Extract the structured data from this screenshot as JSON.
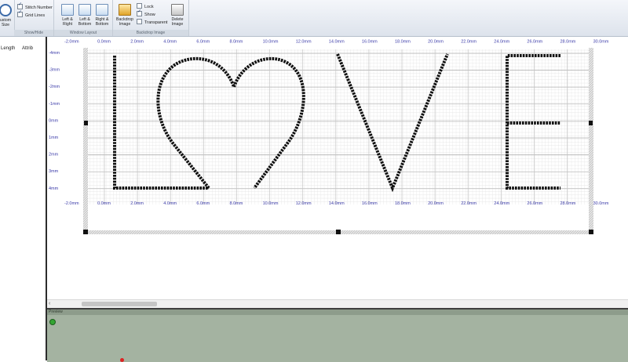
{
  "ribbon": {
    "custom_size_label": "ustom\nSize",
    "show_hide": {
      "caption": "Show/Hide",
      "stitch_number": "Stitch Number",
      "grid_lines": "Grid Lines"
    },
    "window_layout": {
      "caption": "Window Layout",
      "left_right": "Left &\nRight",
      "left_bottom": "Left &\nBottom",
      "right_bottom": "Right &\nBottom"
    },
    "backdrop": {
      "caption": "Backdrop Image",
      "backdrop_image": "Backdrop\nImage",
      "lock": "Lock",
      "show": "Show",
      "transparent": "Transparent",
      "delete_image": "Delete\nImage"
    }
  },
  "left_panel": {
    "col_length": "Length",
    "col_attrib": "Attrib"
  },
  "ruler": {
    "x_labels": [
      "-2.0mm",
      "0.0mm",
      "2.0mm",
      "4.0mm",
      "6.0mm",
      "8.0mm",
      "10.0mm",
      "12.0mm",
      "14.0mm",
      "16.0mm",
      "18.0mm",
      "20.0mm",
      "22.0mm",
      "24.0mm",
      "26.0mm",
      "28.0mm",
      "30.0mm"
    ],
    "y_labels": [
      "-4mm",
      "-3mm",
      "-2mm",
      "-1mm",
      "0mm",
      "1mm",
      "2mm",
      "3mm",
      "4mm"
    ]
  },
  "design_text": "LOVE",
  "preview": {
    "title": "Preview"
  },
  "colors": {
    "ruler_text": "#3a3aa8",
    "stitch": "#111111",
    "grid_fine": "#dcdcdc",
    "grid_major": "#a9a9a9",
    "preview_bg": "#a4b3a1"
  }
}
